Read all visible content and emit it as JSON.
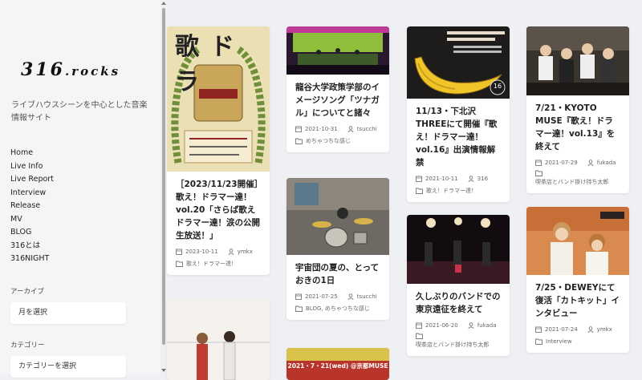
{
  "site": {
    "logo_main": "316",
    "logo_rest": ".rocks",
    "tagline": "ライブハウスシーンを中心とした音楽情報サイト"
  },
  "nav": [
    "Home",
    "Live Info",
    "Live Report",
    "Interview",
    "Release",
    "MV",
    "BLOG",
    "316とは",
    "316NIGHT"
  ],
  "archive": {
    "label": "アーカイブ",
    "select": "月を選択"
  },
  "category": {
    "label": "カテゴリー",
    "select": "カテゴリーを選択"
  },
  "posts": [
    {
      "title": "［2023/11/23開催］歌え！ドラマー達！vol.20「さらば歌えドラマー達！涙の公開生放送！」",
      "date": "2023-10-11",
      "author": "ymkx",
      "category": "歌え！ドラマー達！",
      "image": "poster-uta-dora"
    },
    {
      "title": "龍谷大学政策学部のイメージソング「ツナガル」についてと諸々",
      "date": "2021-10-31",
      "author": "tsucchi",
      "category": "めちゃつちな感じ",
      "image": "concert-stage-green"
    },
    {
      "title": "宇宙団の夏の、とっておきの1日",
      "date": "2021-07-25",
      "author": "tsucchi",
      "category": "BLOG, めちゃつちな感じ",
      "image": "studio-drummer"
    },
    {
      "title": "11/13・下北沢THREEにて開催『歌え！ドラマー達！ vol.16』出演情報解禁",
      "date": "2021-10-11",
      "author": "316",
      "category": "歌え！ドラマー達！",
      "image": "banana-flyer",
      "badge": "16"
    },
    {
      "title": "久しぶりのバンドでの東京遠征を終えて",
      "date": "2021-06-20",
      "author": "fukada",
      "category": "喫茶店とバンド掛け持ち太郎",
      "image": "band-live-stage"
    },
    {
      "title": "7/21・KYOTO MUSE『歌え！ドラマー達！vol.13』を終えて",
      "date": "2021-07-29",
      "author": "fukada",
      "category": "喫茶店とバンド掛け持ち太郎",
      "image": "group-photo"
    },
    {
      "title": "7/25・DEWEYにて復活「カトキット」インタビュー",
      "date": "2021-07-24",
      "author": "ymkx",
      "category": "Interview",
      "image": "two-members-photo"
    }
  ],
  "teasers": {
    "poster_text": "歌ドラ",
    "bottom_banner": "2021・7・21(wed) @京都MUSE"
  }
}
